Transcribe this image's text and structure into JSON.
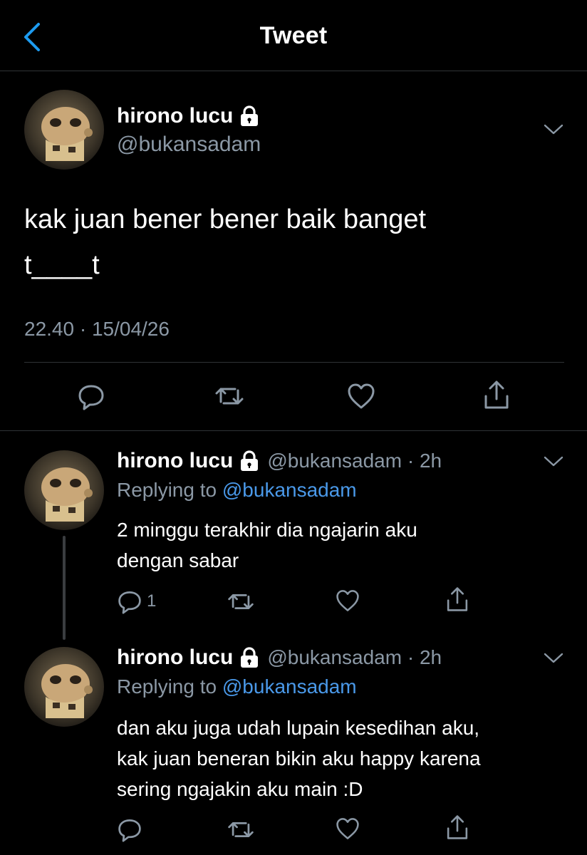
{
  "nav": {
    "title": "Tweet",
    "back_icon": "chevron-left-icon",
    "accent": "#1d9bf0"
  },
  "main_tweet": {
    "display_name": "hirono lucu",
    "handle": "@bukansadam",
    "text_line1": "kak juan bener bener baik banget",
    "text_line2": "t____t",
    "timestamp": "22.40 · 15/04/26",
    "actions": [
      "reply-icon",
      "retweet-icon",
      "like-icon",
      "share-icon"
    ]
  },
  "replies": [
    {
      "display_name": "hirono lucu",
      "handle_time": "@bukansadam · 2h",
      "replying_prefix": "Replying to ",
      "replying_to": "@bukansadam",
      "text_lines": [
        "2 minggu terakhir dia ngajarin aku",
        "dengan sabar"
      ],
      "reply_count": "1"
    },
    {
      "display_name": "hirono lucu",
      "handle_time": "@bukansadam · 2h",
      "replying_prefix": "Replying to ",
      "replying_to": "@bukansadam",
      "text_lines": [
        "dan aku juga udah lupain kesedihan aku,",
        "kak juan beneran bikin aku happy karena",
        "sering ngajakin aku main :D"
      ],
      "reply_count": ""
    }
  ],
  "colors": {
    "background": "#000000",
    "secondary_text": "#8b98a5",
    "link": "#4a99e9",
    "divider": "#2f3336"
  }
}
